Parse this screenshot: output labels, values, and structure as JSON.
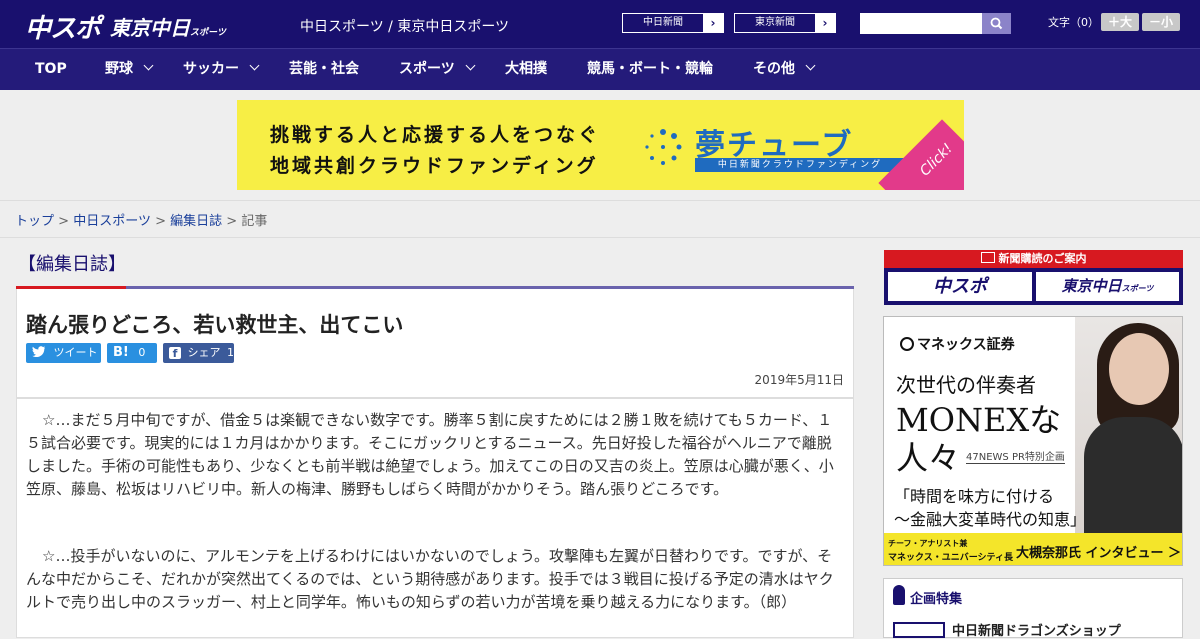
{
  "header": {
    "logo_primary": "中スポ",
    "logo_secondary": "東京中日",
    "logo_secondary_small": "スポーツ",
    "site_title": "中日スポーツ / 東京中日スポーツ",
    "partner_links": [
      "中日新聞",
      "東京新聞"
    ],
    "search_placeholder": "",
    "font_size_label": "文字（0）",
    "font_larger": "＋大",
    "font_smaller": "－小"
  },
  "nav": [
    {
      "label": "TOP",
      "has_dropdown": false
    },
    {
      "label": "野球",
      "has_dropdown": true
    },
    {
      "label": "サッカー",
      "has_dropdown": true
    },
    {
      "label": "芸能・社会",
      "has_dropdown": false
    },
    {
      "label": "スポーツ",
      "has_dropdown": true
    },
    {
      "label": "大相撲",
      "has_dropdown": false
    },
    {
      "label": "競馬・ボート・競輪",
      "has_dropdown": false
    },
    {
      "label": "その他",
      "has_dropdown": true
    }
  ],
  "banner": {
    "line1": "挑戦する人と応援する人をつなぐ",
    "line2": "地域共創クラウドファンディング",
    "brand": "夢チューブ",
    "sub": "中日新聞クラウドファンディング",
    "click": "Click!"
  },
  "breadcrumb": {
    "items": [
      "トップ",
      "中日スポーツ",
      "編集日誌"
    ],
    "current": "記事",
    "separator": ">"
  },
  "article": {
    "category": "【編集日誌】",
    "title": "踏ん張りどころ、若い救世主、出てこい",
    "share": {
      "tweet": "ツイート",
      "hatena_label": "B!",
      "hatena_count": "0",
      "facebook": "シェア",
      "facebook_count": "1"
    },
    "date": "2019年5月11日",
    "paragraphs": [
      "☆…まだ５月中旬ですが、借金５は楽観できない数字です。勝率５割に戻すためには２勝１敗を続けても５カード、１５試合必要です。現実的には１カ月はかかります。そこにガックリとするニュース。先日好投した福谷がヘルニアで離脱しました。手術の可能性もあり、少なくとも前半戦は絶望でしょう。加えてこの日の又吉の炎上。笠原は心臓が悪く、小笠原、藤島、松坂はリハビリ中。新人の梅津、勝野もしばらく時間がかかりそう。踏ん張りどころです。",
      "☆…投手がいないのに、アルモンテを上げるわけにはいかないのでしょう。攻撃陣も左翼が日替わりです。ですが、そんな中だからこそ、だれかが突然出てくるのでは、という期待感があります。投手では３戦目に投げる予定の清水はヤクルトで売り出し中のスラッガー、村上と同学年。怖いもの知らずの若い力が苦境を乗り越える力になります。（郎）"
    ]
  },
  "sidebar": {
    "subscribe_title": "新聞購読のご案内",
    "subscribe_logos": [
      "中スポ",
      "東京中日"
    ],
    "subscribe_logo_small": "スポーツ",
    "ad": {
      "brand": "マネックス証券",
      "title1": "次世代の伴奏者",
      "title2": "MONEXな",
      "title3": "人々",
      "tag": "47NEWS PR特別企画",
      "quote1": "「時間を味方に付ける",
      "quote2": "～金融大変革時代の知恵」",
      "role1": "チーフ・アナリスト兼",
      "role2": "マネックス・ユニバーシティ長",
      "name": "大槻奈那氏 インタビュー ＞"
    },
    "feature_title": "企画特集",
    "feature_item": "中日新聞ドラゴンズショップ"
  },
  "colors": {
    "header_bg": "#19106e",
    "nav_bg": "#241b7a",
    "accent_red": "#d71920",
    "banner_yellow": "#f7ee45",
    "twitter": "#2a90e0",
    "facebook": "#3b5a9a"
  }
}
